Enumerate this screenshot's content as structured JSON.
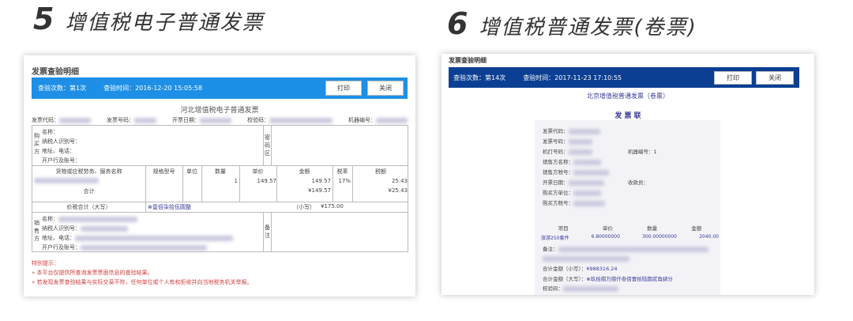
{
  "left": {
    "number": "5",
    "heading": "增值税电子普通发票",
    "panel_title": "发票查验明细",
    "check_count": "查验次数：第1次",
    "check_time": "查验时间：2016-12-20 15:05:58",
    "print": "打印",
    "close": "关闭",
    "invoice_title": "河北增值税电子普通发票",
    "fields": [
      "发票代码：",
      "发票号码：",
      "开票日期：",
      "校验码：",
      "机器编号："
    ],
    "buyer_side": "购买方",
    "buyer_fields": [
      "名称：",
      "纳税人识别号：",
      "地址、电话：",
      "开户行及账号："
    ],
    "password_area": "密码区",
    "columns": [
      "货物或应税劳务、服务名称",
      "规格型号",
      "单位",
      "数量",
      "单价",
      "金额",
      "税率",
      "税额"
    ],
    "row": {
      "quantity": "1",
      "unit_price": "149.57",
      "amount": "149.57",
      "tax_rate": "17%",
      "tax": "25.43"
    },
    "subtotal_label": "合计",
    "subtotal_amount": "¥149.57",
    "subtotal_tax": "¥25.43",
    "total_label": "价税合计（大写）",
    "total_caps": "⊗壹佰柒拾伍圆整",
    "total_small_label": "（小写）",
    "total_small": "¥175.00",
    "seller_side": "销售方",
    "seller_fields": [
      "名称：",
      "纳税人识别号：",
      "地址、电话：",
      "开户行及账号："
    ],
    "remarks": "备注",
    "notice_title": "特别提示：",
    "notices": [
      "本平台仅提供所查询发票票面信息的查验结果。",
      "若发现发票查验结果与实际交易不符，任何单位或个人有权拒收并向当地税务机关举报。"
    ]
  },
  "right": {
    "number": "6",
    "heading": "增值税普通发票(卷票)",
    "panel_title": "发票查验明细",
    "check_count": "查验次数：第14次",
    "check_time": "查验时间：2017-11-23 17:10:55",
    "print": "打印",
    "close": "关闭",
    "invoice_title": "北京增值税普通发票（卷票）",
    "copy_label": "发 票 联",
    "fields": [
      "发票代码：",
      "发票号码：",
      "机打号码：",
      "销售方名称：",
      "销售方税号：",
      "开票日期：",
      "购买方单位：",
      "购买方税号："
    ],
    "machine_no_label": "机器编号：",
    "machine_no": "1",
    "cashier_label": "收款员：",
    "columns": [
      "项目",
      "单价",
      "数量",
      "金额"
    ],
    "row": [
      "旅游250套件",
      "6.80000000",
      "300.00000000",
      "2040.00"
    ],
    "remarks_label": "备注：",
    "total_small_label": "合计金额（小写）：",
    "total_small": "¥988316.24",
    "total_caps_label": "合计金额（大写）：",
    "total_caps": "⊗玖拾捌万捌仟叁佰壹拾陆圆贰角肆分",
    "check_code_label": "校验码："
  },
  "colors": {
    "left_bar": "#1e8fe6",
    "right_bar": "#0b3f93",
    "notice": "#d04040"
  }
}
